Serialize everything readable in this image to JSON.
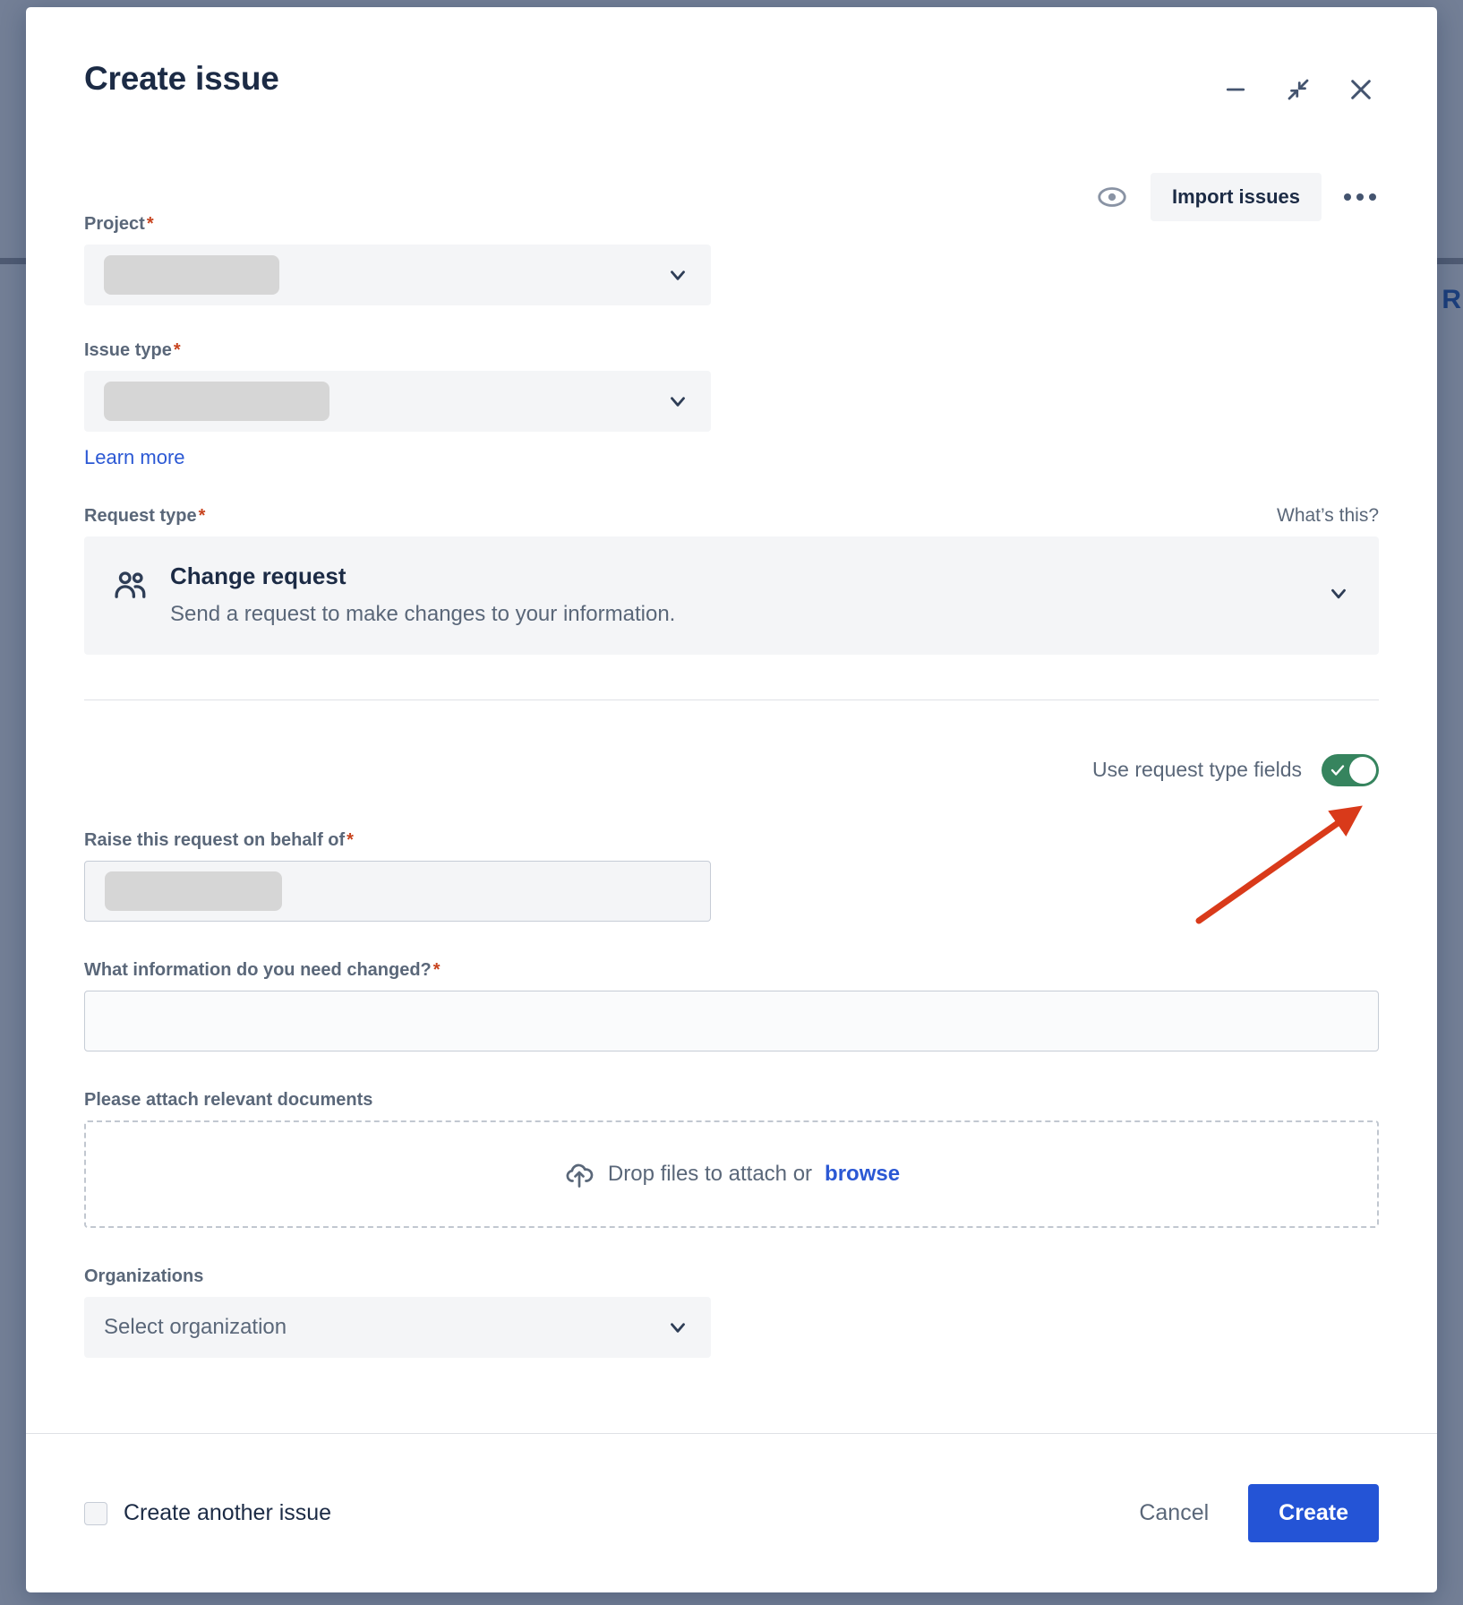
{
  "backdrop": {
    "partial_text_right": "R"
  },
  "modal": {
    "title": "Create issue",
    "window_controls": [
      {
        "name": "minimize",
        "label": "Minimize"
      },
      {
        "name": "collapse",
        "label": "Collapse"
      },
      {
        "name": "close",
        "label": "Close"
      }
    ],
    "header_actions": {
      "preview_icon": "eye-icon",
      "import_label": "Import issues",
      "more_icon": "more-options-icon"
    },
    "fields": {
      "project": {
        "label": "Project",
        "required": true,
        "value": "",
        "state": "loading"
      },
      "issue_type": {
        "label": "Issue type",
        "required": true,
        "value": "",
        "state": "loading",
        "learn_more": "Learn more"
      },
      "request_type": {
        "label": "Request type",
        "required": true,
        "help_link": "What’s this?",
        "icon": "people-group-icon",
        "selected_title": "Change request",
        "selected_desc": "Send a request to make changes to your information."
      },
      "use_request_type_fields": {
        "label": "Use request type fields",
        "on": true
      },
      "behalf_of": {
        "label": "Raise this request on behalf of",
        "required": true,
        "value": "",
        "state": "loading"
      },
      "info_changed": {
        "label": "What information do you need changed?",
        "required": true,
        "value": "",
        "placeholder": ""
      },
      "attachments": {
        "label": "Please attach relevant documents",
        "drop_text": "Drop files to attach or",
        "browse_label": "browse",
        "icon": "cloud-upload-icon"
      },
      "organizations": {
        "label": "Organizations",
        "required": false,
        "placeholder": "Select organization"
      }
    },
    "footer": {
      "create_another_label": "Create another issue",
      "create_another_checked": false,
      "cancel_label": "Cancel",
      "create_label": "Create"
    }
  },
  "colors": {
    "backdrop": "#737f96",
    "primary_blue": "#2454d6",
    "link_blue": "#2b58d4",
    "toggle_green": "#36845e",
    "required_red": "#c8441f",
    "annotation_red": "#d93a1a",
    "title_navy": "#1c2b45",
    "label_gray": "#5a6779",
    "field_bg": "#f4f5f7"
  }
}
